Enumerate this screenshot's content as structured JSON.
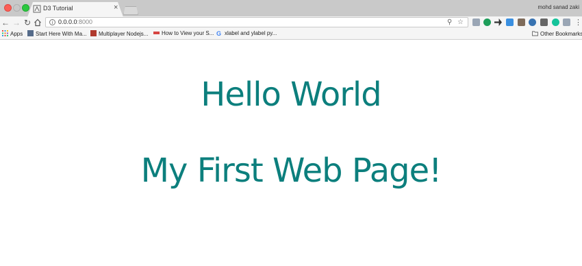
{
  "window": {
    "tab_title": "D3 Tutorial",
    "tab_close": "×",
    "profile_name": "mohd sanad zaki"
  },
  "toolbar": {
    "url_host": "0.0.0.0",
    "url_port": ":8000",
    "info_glyph": "i"
  },
  "bookmarks": {
    "items": [
      {
        "label": "Apps"
      },
      {
        "label": "Start Here With Ma..."
      },
      {
        "label": "Multiplayer Nodejs..."
      },
      {
        "label": "How to View your S..."
      },
      {
        "label": "xlabel and ylabel py..."
      }
    ],
    "other": "Other Bookmarks"
  },
  "page": {
    "heading1": "Hello World",
    "heading2": "My First Web Page!",
    "text_color": "#0c7f7d"
  }
}
